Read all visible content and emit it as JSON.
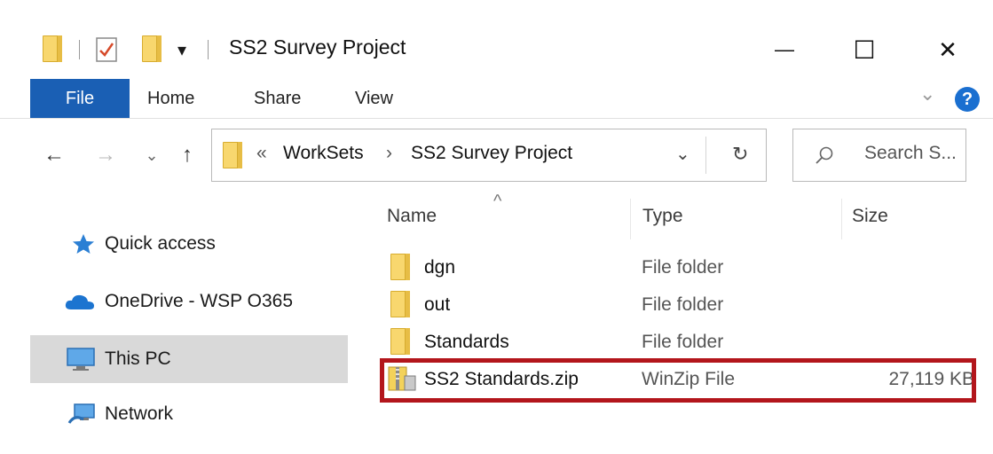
{
  "window": {
    "title": "SS2 Survey Project",
    "controls": {
      "minimize": "—",
      "maximize": "☐",
      "close": "✕"
    }
  },
  "quick_access_toolbar": {
    "dropdown_glyph": "▾"
  },
  "ribbon": {
    "tabs": [
      {
        "label": "File",
        "active": true
      },
      {
        "label": "Home"
      },
      {
        "label": "Share"
      },
      {
        "label": "View"
      }
    ],
    "expand_glyph": "⌄",
    "help_glyph": "?"
  },
  "navigation": {
    "back_glyph": "←",
    "forward_glyph": "→",
    "recent_glyph": "⌄",
    "up_glyph": "↑",
    "breadcrumb": {
      "overflow": "«",
      "items": [
        "WorkSets",
        "SS2 Survey Project"
      ],
      "separator": "›"
    },
    "dropdown_glyph": "⌄",
    "refresh_glyph": "↻",
    "search_placeholder": "Search S..."
  },
  "sidebar": {
    "items": [
      {
        "label": "Quick access",
        "icon": "star-pin-icon"
      },
      {
        "label": "OneDrive - WSP O365",
        "icon": "cloud-icon"
      },
      {
        "label": "This PC",
        "icon": "monitor-icon",
        "selected": true
      },
      {
        "label": "Network",
        "icon": "network-icon"
      }
    ]
  },
  "file_list": {
    "sort_indicator": "^",
    "columns": {
      "name": "Name",
      "type": "Type",
      "size": "Size"
    },
    "rows": [
      {
        "name": "dgn",
        "type": "File folder",
        "size": "",
        "icon": "folder-icon"
      },
      {
        "name": "out",
        "type": "File folder",
        "size": "",
        "icon": "folder-icon"
      },
      {
        "name": "Standards",
        "type": "File folder",
        "size": "",
        "icon": "folder-icon"
      },
      {
        "name": "SS2 Standards.zip",
        "type": "WinZip File",
        "size": "27,119 KB",
        "icon": "zip-icon",
        "highlighted": true
      }
    ]
  },
  "colors": {
    "file_tab": "#1a5fb4",
    "highlight_border": "#b3161c",
    "selected_sidebar": "#d9d9d9",
    "folder": "#f8d76e"
  }
}
